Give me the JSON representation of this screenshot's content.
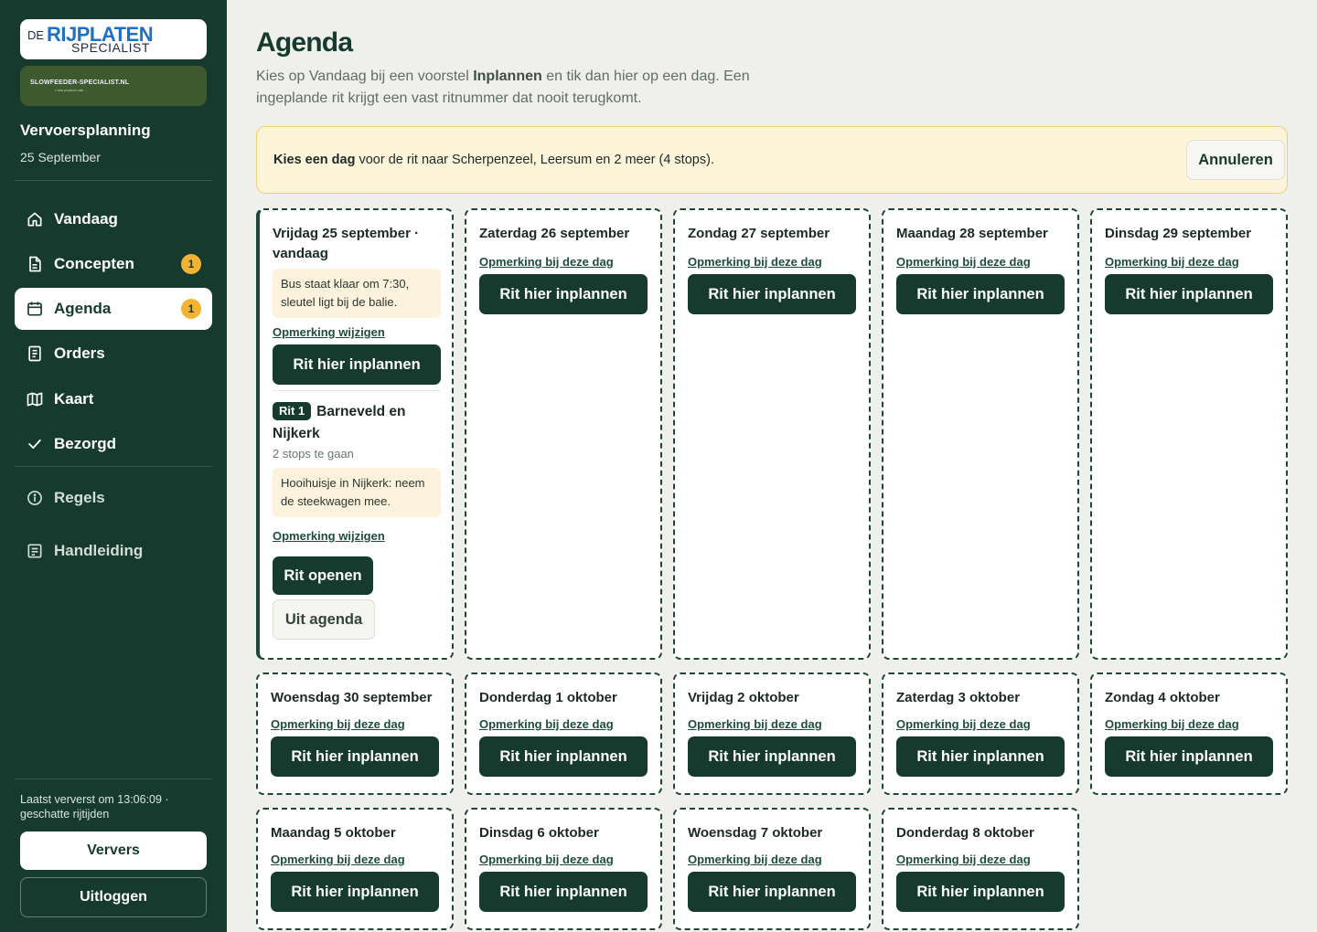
{
  "sidebar": {
    "logo": {
      "de": "DE",
      "rij": "RIJPLATEN",
      "specialist": "SPECIALIST"
    },
    "brand2": {
      "title": "SLOWFEEDER-SPECIALIST.NL",
      "subtitle": "• een product van ..."
    },
    "title": "Vervoersplanning",
    "date": "25 September",
    "nav": [
      {
        "label": "Vandaag",
        "icon": "home-icon"
      },
      {
        "label": "Concepten",
        "icon": "document-icon",
        "badge": "1"
      },
      {
        "label": "Agenda",
        "icon": "calendar-icon",
        "badge": "1",
        "active": true
      },
      {
        "label": "Orders",
        "icon": "list-icon"
      },
      {
        "label": "Kaart",
        "icon": "map-icon"
      },
      {
        "label": "Bezorgd",
        "icon": "check-icon"
      },
      {
        "label": "Regels",
        "icon": "info-icon"
      },
      {
        "label": "Handleiding",
        "icon": "manual-icon"
      }
    ],
    "footer_text": "Laatst ververst om 13:06:09 · geschatte rijtijden",
    "refresh_label": "Ververs",
    "logout_label": "Uitloggen"
  },
  "main": {
    "title": "Agenda",
    "intro_part1": "Kies op Vandaag bij een voorstel ",
    "intro_bold": "Inplannen",
    "intro_part2": " en tik dan hier op een dag. Een ingeplande rit krijgt een vast ritnummer dat nooit terugkomt.",
    "banner_bold": "Kies een dag",
    "banner_text": " voor de rit naar Scherpenzeel, Leersum en 2 meer (4 stops).",
    "cancel_label": "Annuleren",
    "plan_label": "Rit hier inplannen",
    "note_link_label": "Opmerking bij deze dag",
    "days": [
      {
        "title": "Vrijdag 25 september · vandaag",
        "note": "Bus staat klaar om 7:30, sleutel ligt bij de balie.",
        "note_edit_label": "Opmerking wijzigen",
        "rit": {
          "badge": "Rit 1",
          "title": "Barneveld en Nijkerk",
          "sub": "2 stops te gaan",
          "note": "Hooihuisje in Nijkerk: neem de steekwagen mee.",
          "note_edit_label": "Opmerking wijzigen",
          "open_label": "Rit openen",
          "remove_label": "Uit agenda"
        }
      },
      {
        "title": "Zaterdag 26 september"
      },
      {
        "title": "Zondag 27 september"
      },
      {
        "title": "Maandag 28 september"
      },
      {
        "title": "Dinsdag 29 september"
      },
      {
        "title": "Woensdag 30 september"
      },
      {
        "title": "Donderdag 1 oktober"
      },
      {
        "title": "Vrijdag 2 oktober"
      },
      {
        "title": "Zaterdag 3 oktober"
      },
      {
        "title": "Zondag 4 oktober"
      },
      {
        "title": "Maandag 5 oktober"
      },
      {
        "title": "Dinsdag 6 oktober"
      },
      {
        "title": "Woensdag 7 oktober"
      },
      {
        "title": "Donderdag 8 oktober"
      }
    ]
  },
  "colors": {
    "sidebar": "#173a2f",
    "accent": "#173a2f",
    "badge": "#f2b233",
    "banner": "#fdf4da"
  }
}
